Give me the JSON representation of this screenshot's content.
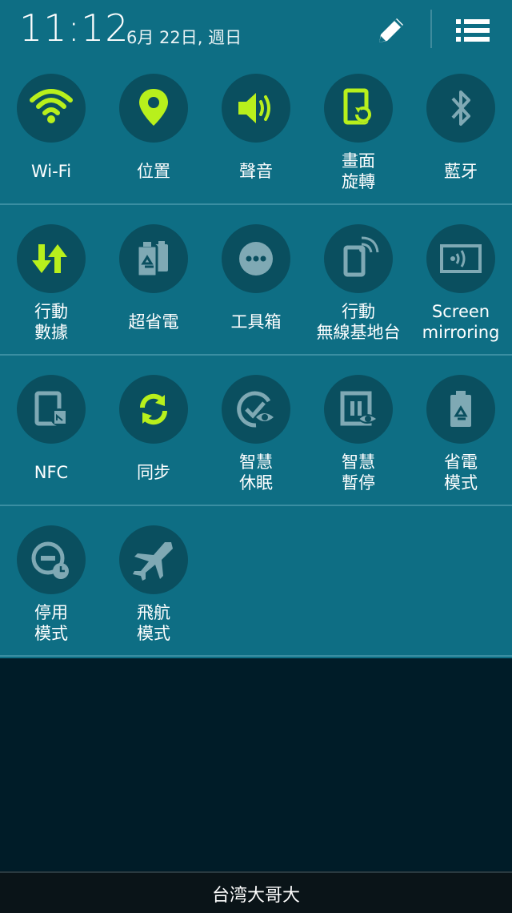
{
  "header": {
    "time": "11:12",
    "date": "6月 22日, 週日"
  },
  "rows": [
    [
      {
        "label": [
          "Wi-Fi"
        ],
        "icon": "wifi-icon",
        "active": true
      },
      {
        "label": [
          "位置"
        ],
        "icon": "location-icon",
        "active": true
      },
      {
        "label": [
          "聲音"
        ],
        "icon": "sound-icon",
        "active": true
      },
      {
        "label": [
          "畫面",
          "旋轉"
        ],
        "icon": "screen-rotation-icon",
        "active": true
      },
      {
        "label": [
          "藍牙"
        ],
        "icon": "bluetooth-icon",
        "active": false
      }
    ],
    [
      {
        "label": [
          "行動",
          "數據"
        ],
        "icon": "mobile-data-icon",
        "active": true
      },
      {
        "label": [
          "超省電"
        ],
        "icon": "ultra-power-saving-icon",
        "active": false
      },
      {
        "label": [
          "工具箱"
        ],
        "icon": "toolbox-icon",
        "active": false
      },
      {
        "label": [
          "行動",
          "無線基地台"
        ],
        "icon": "mobile-hotspot-icon",
        "active": false
      },
      {
        "label": [
          "Screen",
          "mirroring"
        ],
        "icon": "screen-mirroring-icon",
        "active": false
      }
    ],
    [
      {
        "label": [
          "NFC"
        ],
        "icon": "nfc-icon",
        "active": false
      },
      {
        "label": [
          "同步"
        ],
        "icon": "sync-icon",
        "active": true
      },
      {
        "label": [
          "智慧",
          "休眠"
        ],
        "icon": "smart-stay-icon",
        "active": false
      },
      {
        "label": [
          "智慧",
          "暫停"
        ],
        "icon": "smart-pause-icon",
        "active": false
      },
      {
        "label": [
          "省電",
          "模式"
        ],
        "icon": "power-saving-icon",
        "active": false
      }
    ],
    [
      {
        "label": [
          "停用",
          "模式"
        ],
        "icon": "blocking-mode-icon",
        "active": false
      },
      {
        "label": [
          "飛航",
          "模式"
        ],
        "icon": "airplane-icon",
        "active": false
      }
    ]
  ],
  "carrier": "台湾大哥大",
  "colors": {
    "active": "#b8f01c",
    "inactive": "#7fa9b4",
    "panel": "#0e6e84",
    "circle": "#0a4f5f"
  }
}
